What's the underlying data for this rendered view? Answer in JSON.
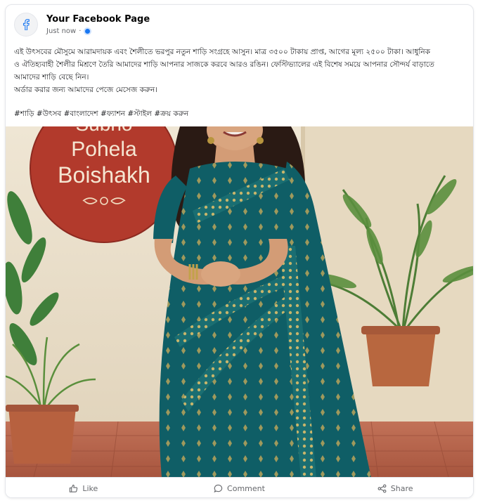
{
  "page": {
    "name": "Your Facebook Page",
    "timestamp": "Just now",
    "separator": "·"
  },
  "post": {
    "body_line_1": "এই উৎসবের মৌসুমে আরামদায়ক এবং শৈলীতে ভরপুর নতুন শাড়ি সংগ্রহে আসুন। মাত্র ৩৫০০ টাকায় প্রাপ্ত, আগের মূল্য ২৫০০ টাকা। আধুনিক",
    "body_line_2": "ও ঐতিহ্যবাহী শৈলীর মিশ্রণে তৈরি আমাদের শাড়ি আপনার সাজকে করবে আরও রঙিন। ফেস্টিভ্যালের এই বিশেষ সময়ে আপনার সৌন্দর্য বাড়াতে",
    "body_line_3": "আমাদের শাড়ি বেছে নিন।",
    "body_line_4": "অর্ডার করার জন্য আমাদের পেজে মেসেজ করুন।",
    "hashtags": "#শাড়ি #উৎসব #বাংলাদেশ #ফ্যাশন #স্টাইল #ক্রয় করুন"
  },
  "photo": {
    "sign_top": "Subho",
    "sign_line_1": "Pohela",
    "sign_line_2": "Boishakh",
    "colors": {
      "wall": "#ece2cf",
      "sign": "#b23a2c",
      "saree": "#0f5e66",
      "saree_border": "#b9a35a",
      "floor": "#b5634a"
    }
  },
  "actions": {
    "like": "Like",
    "comment": "Comment",
    "share": "Share"
  },
  "icons": {
    "avatar": "facebook-f-icon",
    "privacy": "globe-icon",
    "like": "thumbs-up-icon",
    "comment": "speech-bubble-icon",
    "share": "share-nodes-icon"
  }
}
